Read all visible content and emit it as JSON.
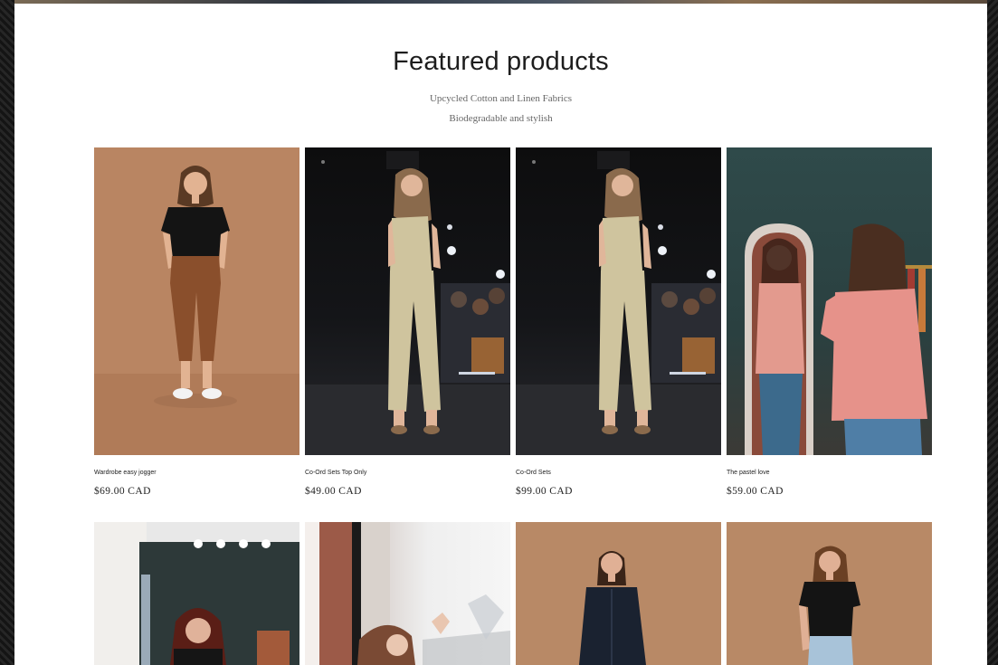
{
  "section": {
    "title": "Featured products",
    "subtitle_line1": "Upcycled Cotton and Linen Fabrics",
    "subtitle_line2": "Biodegradable and stylish"
  },
  "products": [
    {
      "name": "Wardrobe easy jogger",
      "price": "$69.00 CAD",
      "photo": "model-black-top-brown-jogger"
    },
    {
      "name": "Co-Ord Sets Top Only",
      "price": "$49.00 CAD",
      "photo": "runway-beige-coord"
    },
    {
      "name": "Co-Ord Sets",
      "price": "$99.00 CAD",
      "photo": "runway-beige-coord"
    },
    {
      "name": "The pastel love",
      "price": "$59.00 CAD",
      "photo": "model-pink-shirt-mirror"
    },
    {
      "name": "",
      "price": "",
      "photo": "model-studio-black-top"
    },
    {
      "name": "",
      "price": "",
      "photo": "model-window-sitting"
    },
    {
      "name": "",
      "price": "",
      "photo": "model-black-shirt-dress"
    },
    {
      "name": "",
      "price": "",
      "photo": "model-black-top-jeans"
    }
  ],
  "colors": {
    "page_bg": "#ffffff",
    "frame": "#1c1c1c",
    "tan_backdrop": "#b98562",
    "runway_dark": "#0d0d0e",
    "beige_outfit": "#cfc49e",
    "pink_shirt": "#e6928a"
  }
}
